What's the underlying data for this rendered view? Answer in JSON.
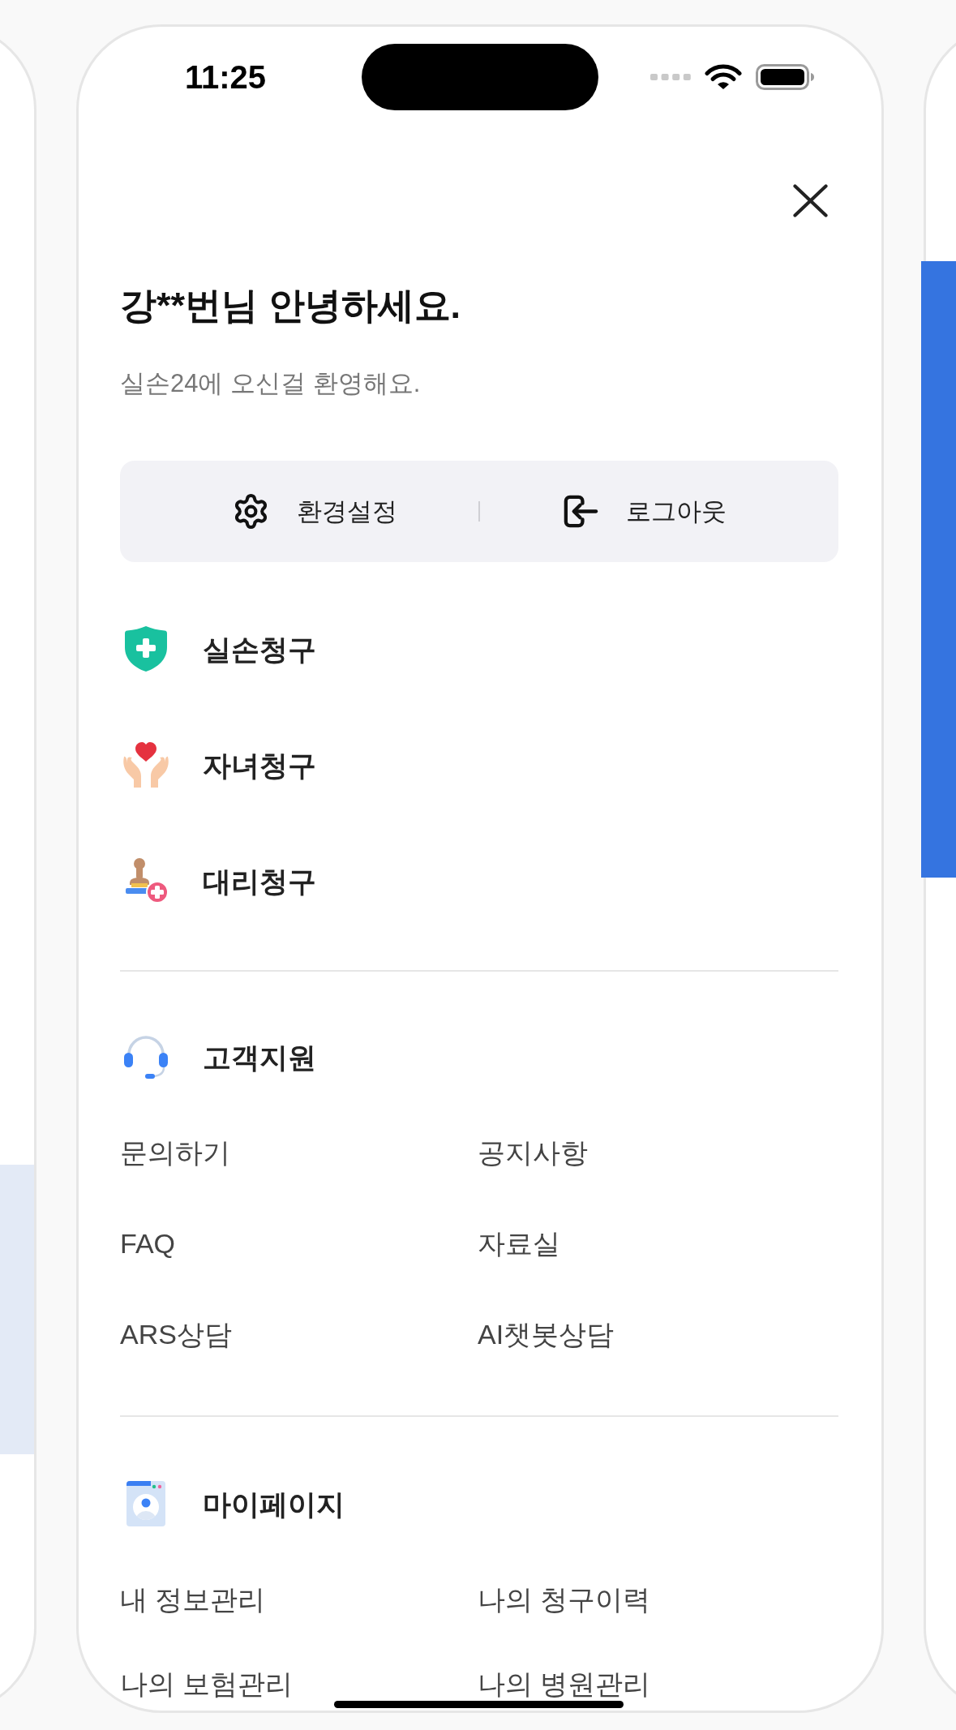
{
  "status_bar": {
    "time": "11:25"
  },
  "greeting": {
    "title": "강**번님 안녕하세요.",
    "subtitle": "실손24에 오신걸 환영해요."
  },
  "quick_actions": [
    {
      "label": "환경설정"
    },
    {
      "label": "로그아웃"
    }
  ],
  "claim_menu": [
    {
      "label": "실손청구"
    },
    {
      "label": "자녀청구"
    },
    {
      "label": "대리청구"
    }
  ],
  "sections": [
    {
      "title": "고객지원",
      "links": [
        "문의하기",
        "공지사항",
        "FAQ",
        "자료실",
        "ARS상담",
        "AI챗봇상담"
      ]
    },
    {
      "title": "마이페이지",
      "links": [
        "내 정보관리",
        "나의 청구이력",
        "나의 보험관리",
        "나의 병원관리"
      ]
    }
  ]
}
